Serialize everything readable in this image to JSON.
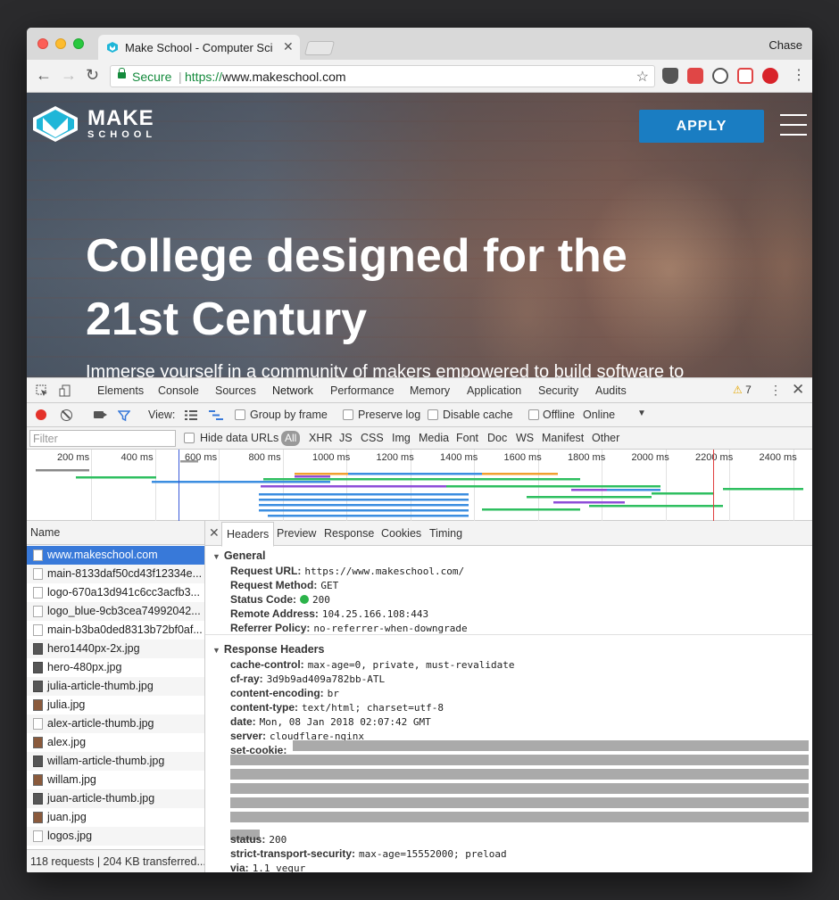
{
  "browser": {
    "tab_title": "Make School - Computer Scien",
    "profile_name": "Chase",
    "secure_label": "Secure",
    "url_scheme": "https://",
    "url_host": "www.makeschool.com"
  },
  "page": {
    "logo_make": "MAKE",
    "logo_school": "SCHOOL",
    "apply_label": "APPLY",
    "headline_line1": "College designed for the",
    "headline_line2": "21st Century",
    "subline": "Immerse yourself in a community of makers empowered to build software to"
  },
  "devtools": {
    "tabs": [
      "Elements",
      "Console",
      "Sources",
      "Network",
      "Performance",
      "Memory",
      "Application",
      "Security",
      "Audits"
    ],
    "active_tab": "Network",
    "warning_count": "7",
    "view_label": "View:",
    "group_by_frame": "Group by frame",
    "preserve_log": "Preserve log",
    "disable_cache": "Disable cache",
    "offline": "Offline",
    "throttle": "Online",
    "filter_placeholder": "Filter",
    "hide_data_urls": "Hide data URLs",
    "types": [
      "All",
      "XHR",
      "JS",
      "CSS",
      "Img",
      "Media",
      "Font",
      "Doc",
      "WS",
      "Manifest",
      "Other"
    ],
    "ticks": [
      "200 ms",
      "400 ms",
      "600 ms",
      "800 ms",
      "1000 ms",
      "1200 ms",
      "1400 ms",
      "1600 ms",
      "1800 ms",
      "2000 ms",
      "2200 ms",
      "2400 ms"
    ],
    "name_header": "Name",
    "files": [
      "www.makeschool.com",
      "main-8133daf50cd43f12334e...",
      "logo-670a13d941c6cc3acfb3...",
      "logo_blue-9cb3cea74992042...",
      "main-b3ba0ded8313b72bf0af...",
      "hero1440px-2x.jpg",
      "hero-480px.jpg",
      "julia-article-thumb.jpg",
      "julia.jpg",
      "alex-article-thumb.jpg",
      "alex.jpg",
      "willam-article-thumb.jpg",
      "willam.jpg",
      "juan-article-thumb.jpg",
      "juan.jpg",
      "logos.jpg"
    ],
    "summary": "118 requests | 204 KB transferred...",
    "detail_tabs": [
      "Headers",
      "Preview",
      "Response",
      "Cookies",
      "Timing"
    ],
    "general": {
      "title": "General",
      "rows": [
        {
          "k": "Request URL:",
          "v": "https://www.makeschool.com/"
        },
        {
          "k": "Request Method:",
          "v": "GET"
        },
        {
          "k": "Status Code:",
          "v": "200"
        },
        {
          "k": "Remote Address:",
          "v": "104.25.166.108:443"
        },
        {
          "k": "Referrer Policy:",
          "v": "no-referrer-when-downgrade"
        }
      ]
    },
    "response_headers": {
      "title": "Response Headers",
      "rows": [
        {
          "k": "cache-control:",
          "v": "max-age=0, private, must-revalidate"
        },
        {
          "k": "cf-ray:",
          "v": "3d9b9ad409a782bb-ATL"
        },
        {
          "k": "content-encoding:",
          "v": "br"
        },
        {
          "k": "content-type:",
          "v": "text/html; charset=utf-8"
        },
        {
          "k": "date:",
          "v": "Mon, 08 Jan 2018 02:07:42 GMT"
        },
        {
          "k": "server:",
          "v": "cloudflare-nginx"
        },
        {
          "k": "set-cookie:",
          "v": ""
        }
      ],
      "rows_after": [
        {
          "k": "status:",
          "v": "200"
        },
        {
          "k": "strict-transport-security:",
          "v": "max-age=15552000; preload"
        },
        {
          "k": "via:",
          "v": "1.1 vegur"
        }
      ]
    }
  }
}
